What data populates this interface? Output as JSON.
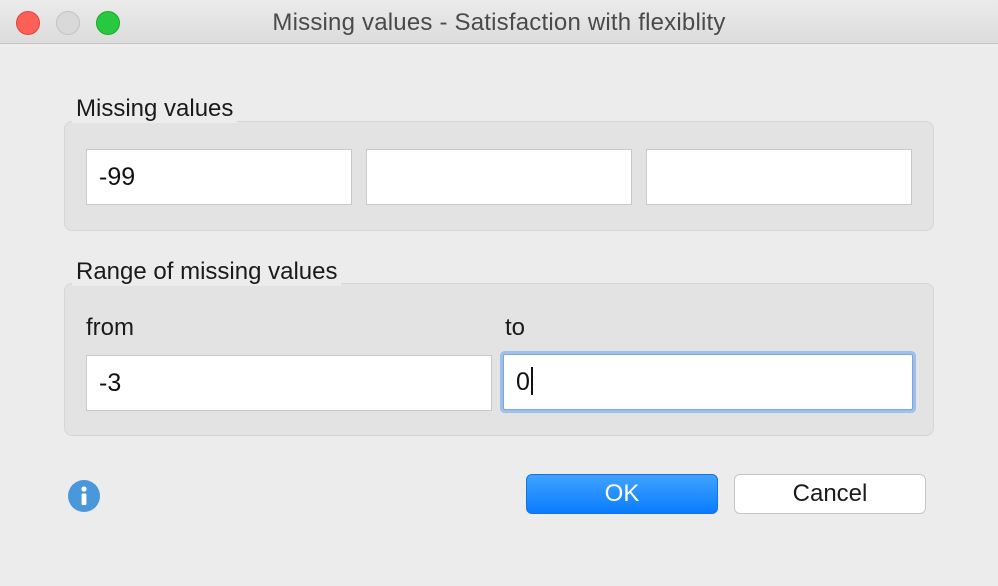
{
  "window": {
    "title": "Missing values - Satisfaction with flexiblity"
  },
  "missing_values": {
    "label": "Missing values",
    "values": [
      "-99",
      "",
      ""
    ]
  },
  "range": {
    "label": "Range of missing values",
    "from_label": "from",
    "to_label": "to",
    "from_value": "-3",
    "to_value": "0"
  },
  "buttons": {
    "ok": "OK",
    "cancel": "Cancel"
  },
  "icons": {
    "info": "info-icon"
  },
  "colors": {
    "accent": "#0a7cff",
    "focus_ring": "#9ec0ea",
    "info": "#4a98db"
  }
}
